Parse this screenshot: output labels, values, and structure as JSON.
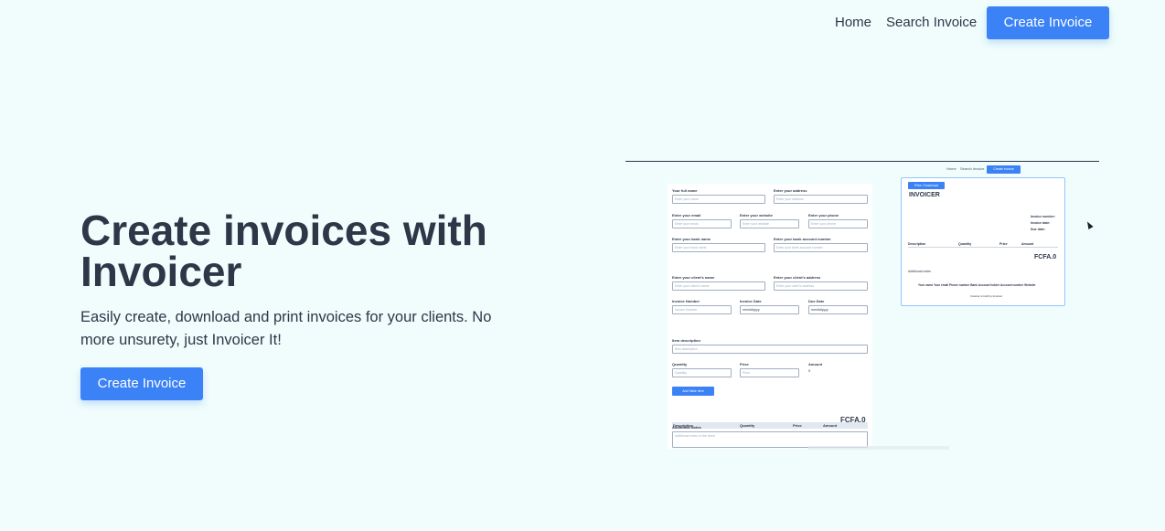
{
  "nav": {
    "home": "Home",
    "search": "Search Invoice",
    "create": "Create Invoice"
  },
  "hero": {
    "title": "Create invoices with Invoicer",
    "subtitle": "Easily create, download and print invoices for your clients. No more unsurety, just Invoicer It!",
    "cta": "Create Invoice"
  },
  "preview": {
    "nav_home": "Home",
    "nav_search": "Search Invoice",
    "nav_create": "Create Invoice",
    "form": {
      "full_name_label": "Your full name",
      "full_name_placeholder": "Enter your name",
      "address_label": "Enter your address",
      "address_placeholder": "Enter your address",
      "email_label": "Enter your email",
      "email_placeholder": "Enter your email",
      "website_label": "Enter your website",
      "website_placeholder": "Enter your website",
      "phone_label": "Enter your phone",
      "phone_placeholder": "Enter your phone",
      "bank_name_label": "Enter your bank name",
      "bank_name_placeholder": "Enter your bank name",
      "bank_account_label": "Enter your bank account number",
      "bank_account_placeholder": "Enter your bank account number",
      "client_name_label": "Enter your client's name",
      "client_name_placeholder": "Enter your client's name",
      "client_address_label": "Enter your client's address",
      "client_address_placeholder": "Enter your client's address",
      "invoice_number_label": "Invoice Number",
      "invoice_number_placeholder": "Invoice Number",
      "invoice_date_label": "Invoice Date",
      "invoice_date_value": "mm/dd/yyyy",
      "due_date_label": "Due Date",
      "due_date_value": "mm/dd/yyyy",
      "item_description_label": "Item description",
      "item_description_placeholder": "Item description",
      "quantity_label": "Quantity",
      "quantity_placeholder": "Quantity",
      "price_label": "Price",
      "price_placeholder": "Price",
      "amount_label": "Amount",
      "amount_value": "0",
      "add_button": "Add Table Item",
      "table_headers": [
        "Description",
        "Quantity",
        "Price",
        "Amount"
      ],
      "total": "FCFA.0",
      "notes_label": "Additional Notes",
      "notes_placeholder": "Additional notes to the client"
    },
    "invoice": {
      "print_button": "Print / Download",
      "title": "INVOICER",
      "meta": [
        "Invoice number:",
        "Invoice date:",
        "Due date:"
      ],
      "table_headers": [
        "Description",
        "Quantity",
        "Price",
        "Amount"
      ],
      "total": "FCFA.0",
      "notes": "Additional notes",
      "footer": "Your name  Your email  Phone number  Bank  Account holder  Account number  Website",
      "credit": "Invoicer is built by Invoicer"
    }
  },
  "colors": {
    "background": "#f0fdfc",
    "accent": "#3b82f6",
    "text": "#2d3748"
  }
}
